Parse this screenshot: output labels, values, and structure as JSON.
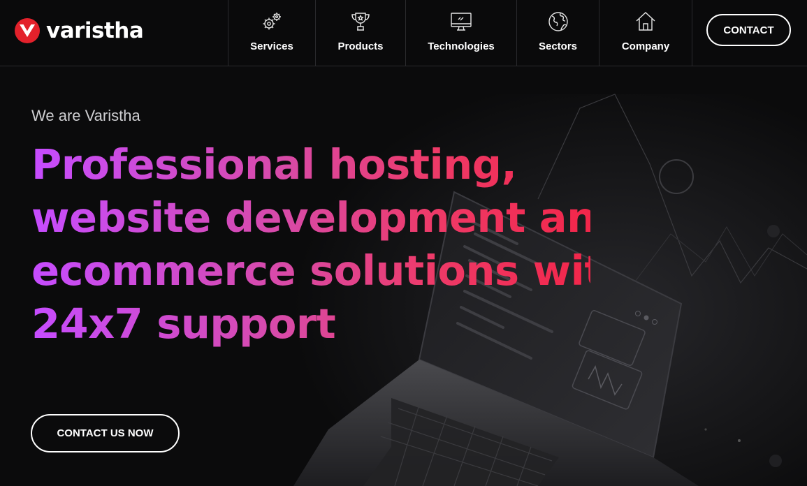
{
  "brand": {
    "name": "varistha",
    "accent": "#e3212b"
  },
  "nav": {
    "items": [
      {
        "label": "Services",
        "icon": "gears-icon"
      },
      {
        "label": "Products",
        "icon": "trophy-icon"
      },
      {
        "label": "Technologies",
        "icon": "monitor-icon"
      },
      {
        "label": "Sectors",
        "icon": "globe-icon"
      },
      {
        "label": "Company",
        "icon": "home-icon"
      }
    ],
    "contact_label": "CONTACT"
  },
  "hero": {
    "tagline": "We are Varistha",
    "headline_lines": [
      "Professional hosting,",
      "website development and",
      "ecommerce solutions with",
      "24x7 support"
    ],
    "cta_label": "CONTACT US NOW",
    "gradient": [
      "#c64cff",
      "#d84aa8",
      "#ee3a68",
      "#f2264a"
    ]
  }
}
